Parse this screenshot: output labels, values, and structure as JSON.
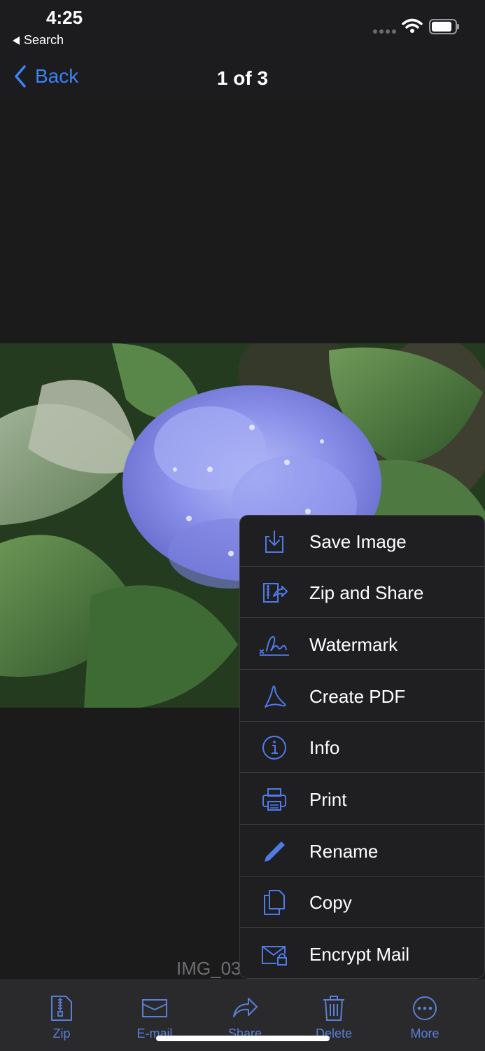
{
  "status_bar": {
    "time": "4:25",
    "back_app_label": "Search"
  },
  "nav": {
    "back_label": "Back",
    "title": "1 of 3"
  },
  "viewer": {
    "filename": "IMG_03"
  },
  "menu": {
    "items": [
      {
        "label": "Save Image",
        "icon": "save-image-icon"
      },
      {
        "label": "Zip and Share",
        "icon": "zip-share-icon"
      },
      {
        "label": "Watermark",
        "icon": "watermark-signature-icon"
      },
      {
        "label": "Create PDF",
        "icon": "pdf-icon"
      },
      {
        "label": "Info",
        "icon": "info-icon"
      },
      {
        "label": "Print",
        "icon": "print-icon"
      },
      {
        "label": "Rename",
        "icon": "pencil-icon"
      },
      {
        "label": "Copy",
        "icon": "copy-icon"
      },
      {
        "label": "Encrypt Mail",
        "icon": "encrypt-mail-icon"
      }
    ]
  },
  "tabs": [
    {
      "label": "Zip",
      "icon": "zip-file-icon"
    },
    {
      "label": "E-mail",
      "icon": "envelope-icon"
    },
    {
      "label": "Share",
      "icon": "share-arrow-icon"
    },
    {
      "label": "Delete",
      "icon": "trash-icon"
    },
    {
      "label": "More",
      "icon": "more-ellipsis-icon"
    }
  ],
  "colors": {
    "accent": "#3c82f6",
    "tab_tint": "#5a7fd6",
    "menu_bg": "#1f1f21",
    "background": "#1c1c1e"
  }
}
